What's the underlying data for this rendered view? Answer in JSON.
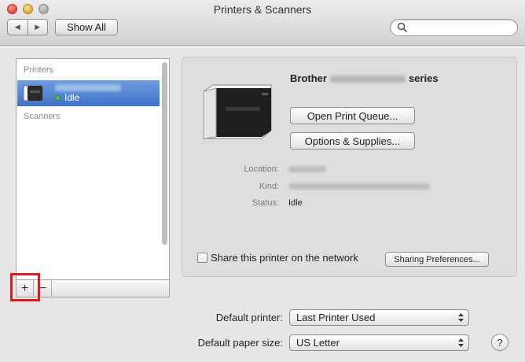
{
  "window": {
    "title": "Printers & Scanners"
  },
  "toolbar": {
    "show_all_label": "Show All",
    "search_placeholder": ""
  },
  "sidebar": {
    "printers_header": "Printers",
    "scanners_header": "Scanners",
    "printers": [
      {
        "status": "Idle",
        "selected": true
      }
    ],
    "add_label": "+",
    "remove_label": "−"
  },
  "detail": {
    "name_prefix": "Brother",
    "name_suffix": "series",
    "open_queue_label": "Open Print Queue...",
    "options_label": "Options & Supplies...",
    "location_label": "Location:",
    "kind_label": "Kind:",
    "status_label": "Status:",
    "status_value": "Idle",
    "share_label": "Share this printer on the network",
    "sharing_prefs_label": "Sharing Preferences..."
  },
  "footer": {
    "default_printer_label": "Default printer:",
    "default_printer_value": "Last Printer Used",
    "paper_size_label": "Default paper size:",
    "paper_size_value": "US Letter",
    "help_label": "?"
  },
  "colors": {
    "selection": "#3d72c9",
    "highlight_box": "#e0191c",
    "idle_dot": "#58c24e"
  }
}
